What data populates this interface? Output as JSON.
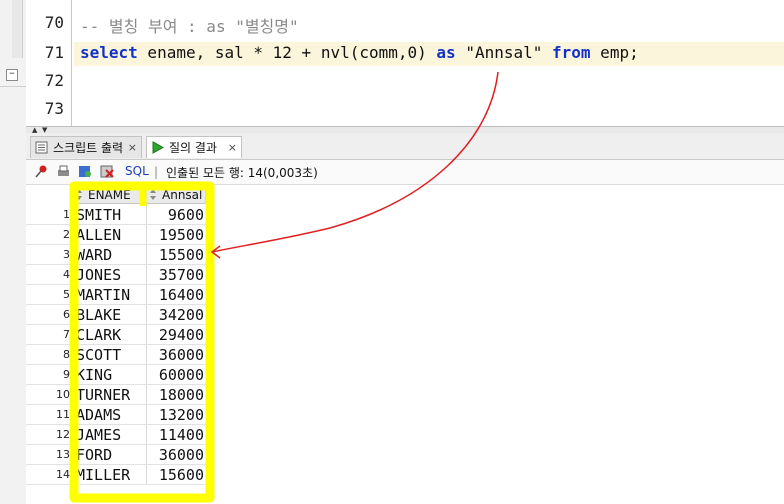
{
  "editor": {
    "lines": [
      {
        "number": "70",
        "text": "-- 별칭 부여 : as \"별칭명\""
      },
      {
        "number": "71",
        "parts": {
          "kw_select": "select",
          "mid1": " ename, sal * 12 + nvl(comm,0) ",
          "kw_as": "as",
          "mid2": " \"Annsal\" ",
          "kw_from": "from",
          "tail": " emp;"
        }
      },
      {
        "number": "72",
        "text": ""
      },
      {
        "number": "73",
        "text": ""
      }
    ]
  },
  "tabs": [
    {
      "label": "스크립트 출력",
      "close": "×",
      "icon": "script-output-icon"
    },
    {
      "label": "질의 결과",
      "close": "×",
      "icon": "run-query-icon"
    }
  ],
  "toolbar": {
    "sql_label": "SQL",
    "separator": "|",
    "status": "인출된 모든 행: 14(0,003초)"
  },
  "grid": {
    "columns": [
      "ENAME",
      "Annsal"
    ],
    "rows": [
      {
        "n": "1",
        "ename": "SMITH",
        "annsal": "9600"
      },
      {
        "n": "2",
        "ename": "ALLEN",
        "annsal": "19500"
      },
      {
        "n": "3",
        "ename": "WARD",
        "annsal": "15500"
      },
      {
        "n": "4",
        "ename": "JONES",
        "annsal": "35700"
      },
      {
        "n": "5",
        "ename": "MARTIN",
        "annsal": "16400"
      },
      {
        "n": "6",
        "ename": "BLAKE",
        "annsal": "34200"
      },
      {
        "n": "7",
        "ename": "CLARK",
        "annsal": "29400"
      },
      {
        "n": "8",
        "ename": "SCOTT",
        "annsal": "36000"
      },
      {
        "n": "9",
        "ename": "KING",
        "annsal": "60000"
      },
      {
        "n": "10",
        "ename": "TURNER",
        "annsal": "18000"
      },
      {
        "n": "11",
        "ename": "ADAMS",
        "annsal": "13200"
      },
      {
        "n": "12",
        "ename": "JAMES",
        "annsal": "11400"
      },
      {
        "n": "13",
        "ename": "FORD",
        "annsal": "36000"
      },
      {
        "n": "14",
        "ename": "MILLER",
        "annsal": "15600"
      }
    ]
  },
  "colors": {
    "keyword": "#1432c8",
    "comment": "#8a8a8a",
    "highlight_marker": "#ffff00",
    "annotation_arrow": "#e02020",
    "current_line": "#fbf5dc"
  }
}
